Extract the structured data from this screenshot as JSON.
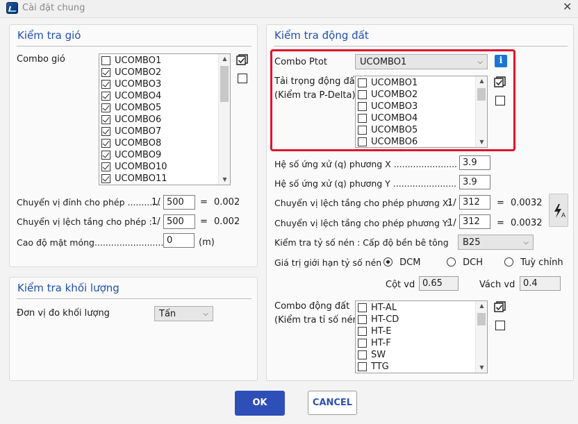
{
  "window": {
    "title": "Cài đặt chung",
    "close_glyph": "✕"
  },
  "wind": {
    "title": "Kiểm tra gió",
    "combo_label": "Combo gió",
    "items": [
      {
        "label": "UCOMBO1",
        "checked": false
      },
      {
        "label": "UCOMBO2",
        "checked": true
      },
      {
        "label": "UCOMBO3",
        "checked": true
      },
      {
        "label": "UCOMBO4",
        "checked": true
      },
      {
        "label": "UCOMBO5",
        "checked": true
      },
      {
        "label": "UCOMBO6",
        "checked": true
      },
      {
        "label": "UCOMBO7",
        "checked": true
      },
      {
        "label": "UCOMBO8",
        "checked": true
      },
      {
        "label": "UCOMBO9",
        "checked": true
      },
      {
        "label": "UCOMBO10",
        "checked": true
      },
      {
        "label": "UCOMBO11",
        "checked": true
      }
    ],
    "top_disp_label": "Chuyển vị đỉnh cho phép ............",
    "top_disp_prefix": "1/",
    "top_disp_value": "500",
    "top_disp_eq": "=",
    "top_disp_result": "0.002",
    "drift_label": "Chuyển vị lệch tầng cho phép :",
    "drift_prefix": "1/",
    "drift_value": "500",
    "drift_eq": "=",
    "drift_result": "0.002",
    "foundation_label": "Cao độ mặt móng...............................",
    "foundation_value": "0",
    "foundation_unit": "(m)"
  },
  "mass": {
    "title": "Kiểm tra khối lượng",
    "unit_label": "Đơn vị đo khối lượng",
    "unit_value": "Tấn"
  },
  "quake": {
    "title": "Kiểm tra động đất",
    "ptot_label": "Combo Ptot",
    "ptot_value": "UCOMBO1",
    "info_glyph": "i",
    "load_label_1": "Tải trọng động đất",
    "load_label_2": "(Kiểm tra P-Delta)",
    "load_items": [
      {
        "label": "UCOMBO1",
        "checked": false
      },
      {
        "label": "UCOMBO2",
        "checked": false
      },
      {
        "label": "UCOMBO3",
        "checked": false
      },
      {
        "label": "UCOMBO4",
        "checked": false
      },
      {
        "label": "UCOMBO5",
        "checked": false
      },
      {
        "label": "UCOMBO6",
        "checked": false
      }
    ],
    "qx_label": "Hệ số ứng xử (q) phương X .................................",
    "qx_value": "3.9",
    "qy_label": "Hệ số ứng xử (q) phương Y .................................",
    "qy_value": "3.9",
    "driftx_label": "Chuyển vị lệch tầng cho phép phương X:",
    "driftx_prefix": "1/",
    "driftx_value": "312",
    "driftx_eq": "=",
    "driftx_result": "0.0032",
    "drifty_label": "Chuyển vị lệch tầng cho phép phương Y:",
    "drifty_prefix": "1/",
    "drifty_value": "312",
    "drifty_eq": "=",
    "drifty_result": "0.0032",
    "concrete_label": "Kiểm tra tỷ số nén : Cấp độ bền bê tông",
    "concrete_value": "B25",
    "limit_label": "Giá trị giới hạn tỷ số nén :",
    "radio_dcm": "DCM",
    "radio_dch": "DCH",
    "radio_custom": "Tuỳ chỉnh",
    "col_label": "Cột vd",
    "col_value": "0.65",
    "wall_label": "Vách vd",
    "wall_value": "0.4",
    "combo_label_1": "Combo động đất",
    "combo_label_2": "(Kiểm tra tỉ số nén)",
    "combo_items": [
      {
        "label": "HT-AL",
        "checked": false
      },
      {
        "label": "HT-CD",
        "checked": false
      },
      {
        "label": "HT-E",
        "checked": false
      },
      {
        "label": "HT-F",
        "checked": false
      },
      {
        "label": "SW",
        "checked": false
      },
      {
        "label": "TTG",
        "checked": false
      }
    ]
  },
  "footer": {
    "ok_label": "OK",
    "cancel_label": "CANCEL"
  },
  "colors": {
    "accent": "#2e4fb8",
    "title_blue": "#1f4fb0",
    "highlight_red": "#e0102a"
  }
}
